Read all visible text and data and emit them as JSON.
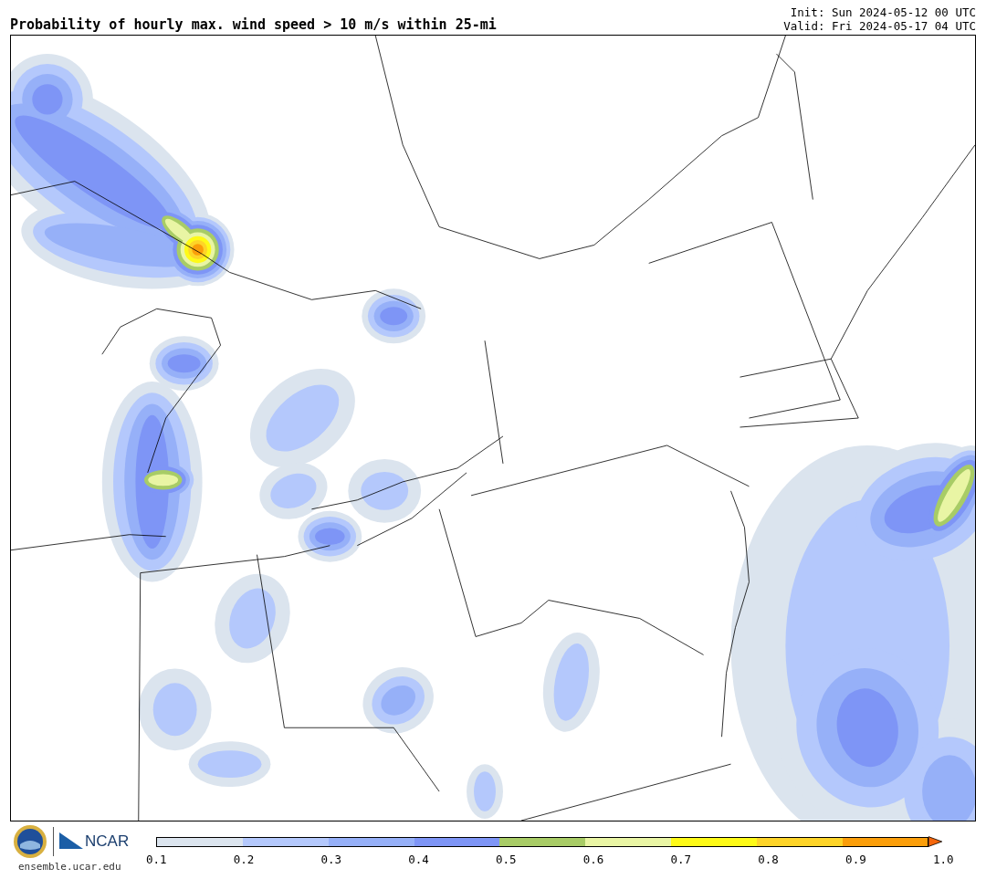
{
  "title": "Probability of hourly max. wind speed > 10 m/s within 25-mi",
  "init": "Init: Sun 2024-05-12 00 UTC",
  "valid": "Valid: Fri 2024-05-17 04 UTC",
  "logo_text": "NCAR",
  "website": "ensemble.ucar.edu",
  "colorbar": {
    "bins": [
      {
        "color": "#dbe4ee"
      },
      {
        "color": "#b4c8fc"
      },
      {
        "color": "#96b0f8"
      },
      {
        "color": "#7e95f6"
      },
      {
        "color": "#a8cc66"
      },
      {
        "color": "#e9f5a4"
      },
      {
        "color": "#fefa17"
      },
      {
        "color": "#fed428"
      },
      {
        "color": "#fb9e0a"
      }
    ],
    "extend": {
      "color": "#f5660c"
    },
    "ticks": [
      "0.1",
      "0.2",
      "0.3",
      "0.4",
      "0.5",
      "0.6",
      "0.7",
      "0.8",
      "0.9",
      "1.0"
    ]
  }
}
